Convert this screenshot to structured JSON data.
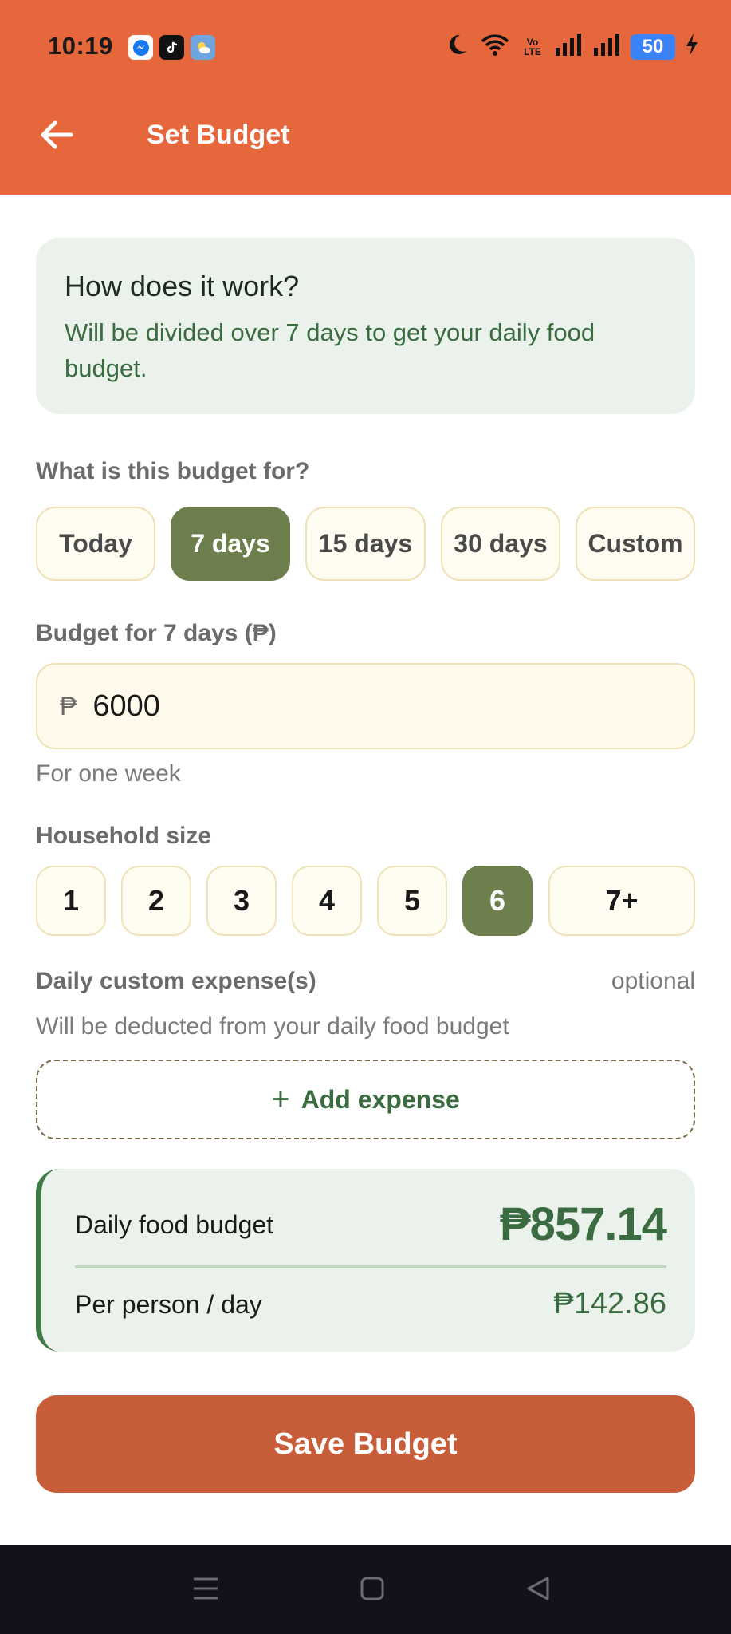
{
  "status_bar": {
    "time": "10:19",
    "battery": "50",
    "volte": "Vo LTE"
  },
  "app_bar": {
    "title": "Set Budget"
  },
  "info_card": {
    "title": "How does it work?",
    "text": "Will be divided over 7 days to get your daily food budget."
  },
  "period": {
    "label": "What is this budget for?",
    "options": [
      "Today",
      "7 days",
      "15 days",
      "30 days",
      "Custom"
    ],
    "selected": "7 days"
  },
  "budget": {
    "label": "Budget for 7 days (₱)",
    "currency_symbol": "₱",
    "value": "6000",
    "hint": "For one week"
  },
  "household": {
    "label": "Household size",
    "options": [
      "1",
      "2",
      "3",
      "4",
      "5",
      "6",
      "7+"
    ],
    "selected": "6"
  },
  "expenses": {
    "label": "Daily custom expense(s)",
    "optional": "optional",
    "hint": "Will be deducted from your daily food budget",
    "add_icon": "+",
    "add_label": "Add expense"
  },
  "summary": {
    "daily_label": "Daily food budget",
    "daily_value": "₱857.14",
    "per_person_label": "Per person / day",
    "per_person_value": "₱142.86"
  },
  "save_button": "Save Budget",
  "colors": {
    "app_bar": "#E6673C",
    "accent_green": "#3B6B41",
    "selected_chip": "#6C7F4C",
    "save_button": "#C85D3A"
  }
}
